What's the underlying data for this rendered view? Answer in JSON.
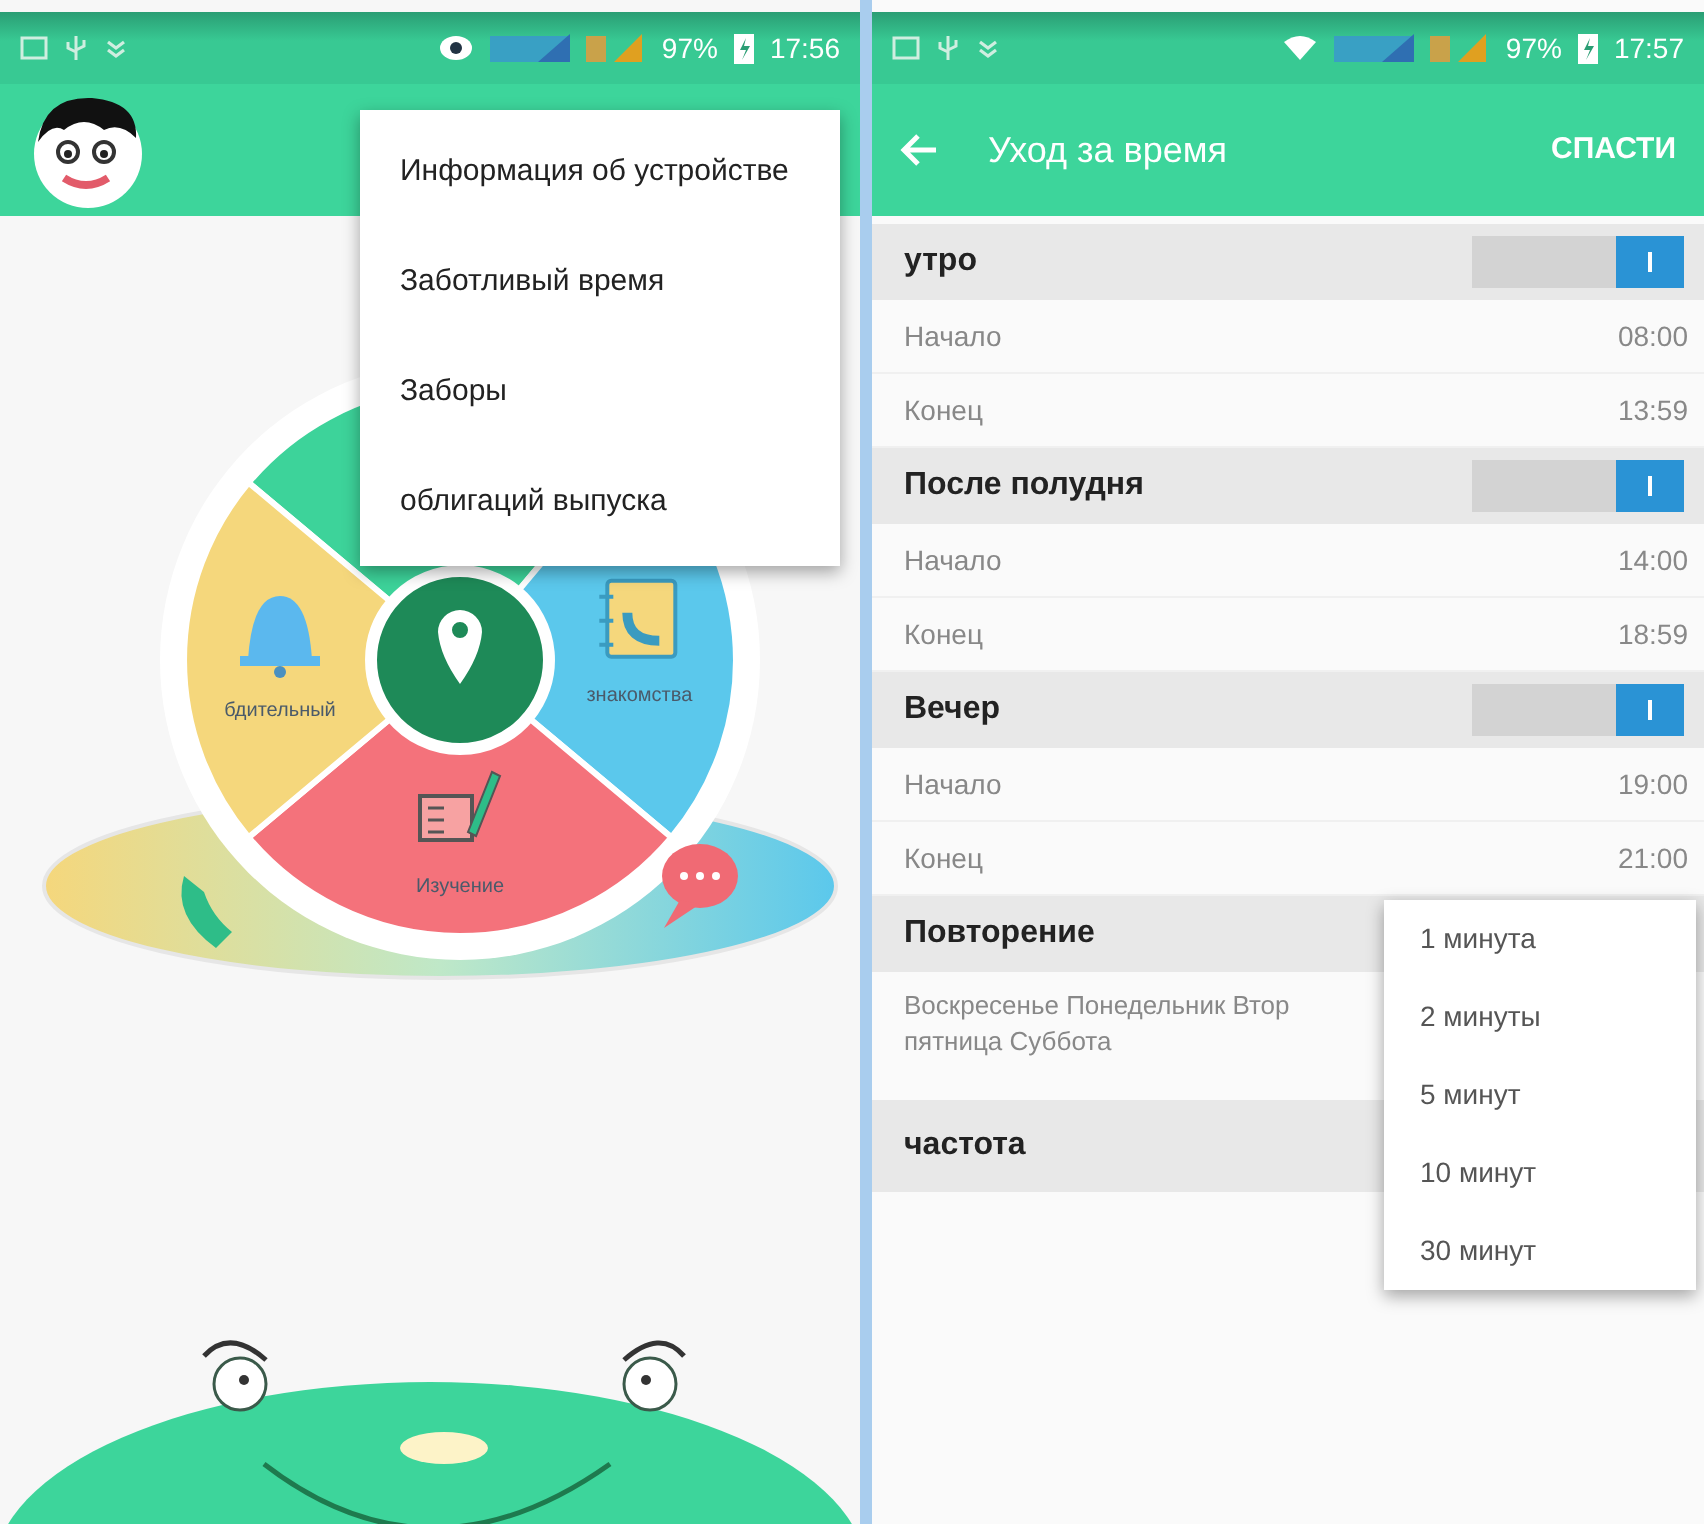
{
  "left_screen": {
    "status_bar": {
      "battery": "97%",
      "time": "17:56"
    },
    "menu": [
      {
        "label": "Информация об устройстве"
      },
      {
        "label": "Заботливый время"
      },
      {
        "label": "Заборы"
      },
      {
        "label": "облигаций выпуска"
      }
    ],
    "wheel": {
      "segments": [
        {
          "kind": "plain",
          "color": "#3dd39a"
        },
        {
          "kind": "contacts",
          "color": "#5bc8ec",
          "label": "знакомства"
        },
        {
          "kind": "study",
          "color": "#f4727b",
          "label": "Изучение"
        },
        {
          "kind": "bell",
          "color": "#f5d77c",
          "label": "бдительный"
        }
      ]
    }
  },
  "right_screen": {
    "status_bar": {
      "battery": "97%",
      "time": "17:57"
    },
    "app_bar": {
      "title": "Уход за время",
      "action": "СПАСТИ"
    },
    "sections": [
      {
        "title": "утро",
        "on": true,
        "rows": [
          {
            "label": "Начало",
            "value": "08:00"
          },
          {
            "label": "Конец",
            "value": "13:59"
          }
        ]
      },
      {
        "title": "После полудня",
        "on": true,
        "rows": [
          {
            "label": "Начало",
            "value": "14:00"
          },
          {
            "label": "Конец",
            "value": "18:59"
          }
        ]
      },
      {
        "title": "Вечер",
        "on": true,
        "rows": [
          {
            "label": "Начало",
            "value": "19:00"
          },
          {
            "label": "Конец",
            "value": "21:00"
          }
        ]
      }
    ],
    "repeat": {
      "title": "Повторение",
      "days": [
        "Воскресенье Понедельник Втор",
        "пятница Суббота"
      ]
    },
    "frequency": {
      "title": "частота"
    },
    "dropdown": [
      {
        "label": "1 минута"
      },
      {
        "label": "2 минуты"
      },
      {
        "label": "5 минут"
      },
      {
        "label": "10 минут"
      },
      {
        "label": "30 минут"
      }
    ]
  }
}
